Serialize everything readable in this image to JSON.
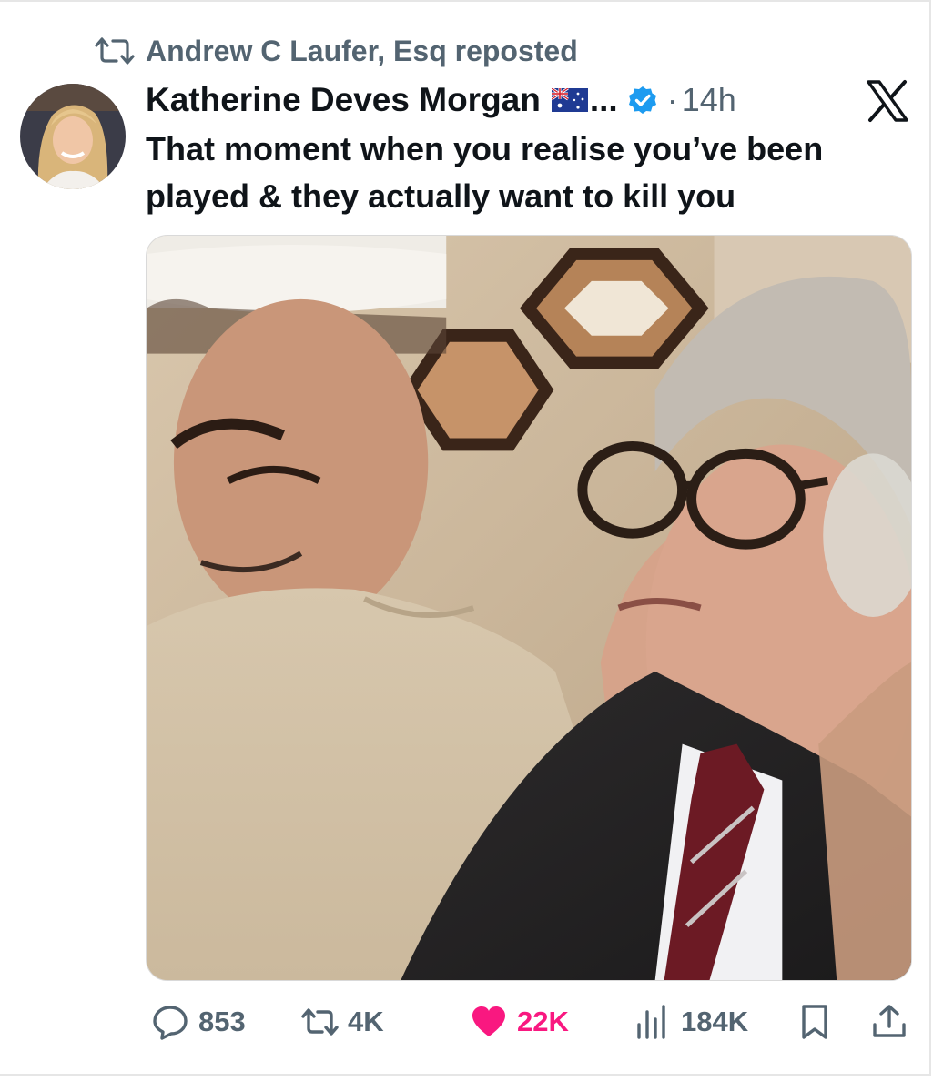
{
  "repost": {
    "label": "Andrew C Laufer, Esq reposted",
    "icon": "repost-icon"
  },
  "tweet": {
    "author_name": "Katherine Deves Morgan",
    "flag": "australia-flag-icon",
    "ellipsis": "...",
    "verified": "verified-badge-icon",
    "separator": "·",
    "time": "14h",
    "text": "That moment when you realise you’ve been played & they actually want to kill you",
    "media_icon": "photo"
  },
  "actions": {
    "replies": "853",
    "reposts": "4K",
    "likes": "22K",
    "views": "184K"
  },
  "colors": {
    "muted": "#536471",
    "like": "#f91880",
    "verified": "#1d9bf0",
    "text": "#0f1419"
  }
}
